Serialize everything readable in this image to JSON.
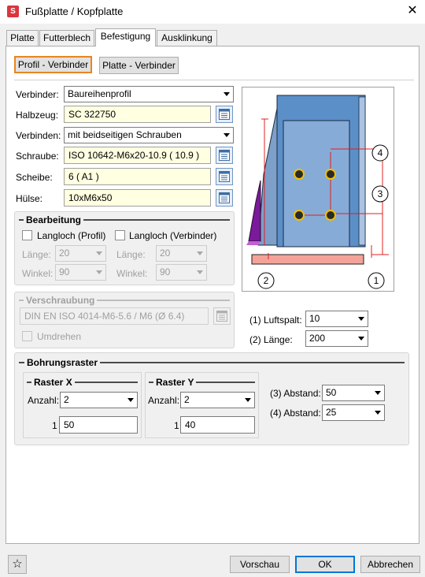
{
  "window": {
    "title": "Fußplatte / Kopfplatte",
    "app_icon_glyph": "S"
  },
  "tabs": [
    {
      "label": "Platte"
    },
    {
      "label": "Futterblech"
    },
    {
      "label": "Befestigung",
      "active": true
    },
    {
      "label": "Ausklinkung"
    }
  ],
  "mode_buttons": {
    "profile_connector": "Profil - Verbinder",
    "plate_connector": "Platte - Verbinder",
    "active": "profile_connector"
  },
  "fields": {
    "verbinder": {
      "label": "Verbinder:",
      "value": "Baureihenprofil"
    },
    "halbzeug": {
      "label": "Halbzeug:",
      "value": "SC  322750"
    },
    "verbinden": {
      "label": "Verbinden:",
      "value": "mit beidseitigen Schrauben"
    },
    "schraube": {
      "label": "Schraube:",
      "value": "ISO 10642-M6x20-10.9  ( 10.9 )"
    },
    "scheibe": {
      "label": "Scheibe:",
      "value": "6  ( A1 )"
    },
    "huelse": {
      "label": "Hülse:",
      "value": "10xM6x50"
    }
  },
  "bearbeitung": {
    "title": "Bearbeitung",
    "langloch_profil": "Langloch (Profil)",
    "langloch_verbinder": "Langloch (Verbinder)",
    "laenge_label": "Länge:",
    "winkel_label": "Winkel:",
    "profil_laenge": "20",
    "profil_winkel": "90",
    "verbinder_laenge": "20",
    "verbinder_winkel": "90"
  },
  "verschraubung": {
    "title": "Verschraubung",
    "value": "DIN EN ISO 4014-M6-5.6 / M6 (Ø 6.4)",
    "umdrehen": "Umdrehen"
  },
  "preview_params": {
    "luftspalt_label": "(1) Luftspalt:",
    "luftspalt": "10",
    "laenge_label": "(2) Länge:",
    "laenge": "200"
  },
  "preview_markers": [
    "1",
    "2",
    "3",
    "4"
  ],
  "bohrungsraster": {
    "title": "Bohrungsraster",
    "raster_x": {
      "title": "Raster X",
      "anzahl_label": "Anzahl:",
      "anzahl": "2",
      "row_index": "1",
      "row_value": "50"
    },
    "raster_y": {
      "title": "Raster Y",
      "anzahl_label": "Anzahl:",
      "anzahl": "2",
      "row_index": "1",
      "row_value": "40"
    },
    "abstand3_label": "(3) Abstand:",
    "abstand3": "50",
    "abstand4_label": "(4) Abstand:",
    "abstand4": "25"
  },
  "footer": {
    "preview": "Vorschau",
    "ok": "OK",
    "cancel": "Abbrechen"
  },
  "colors": {
    "accent_orange": "#e8851f",
    "field_yellow": "#ffffe1",
    "default_blue": "#0078d7",
    "profile_blue": "#5b8fc8",
    "plate_red": "#f4a39a",
    "dim_red": "#e02020"
  }
}
